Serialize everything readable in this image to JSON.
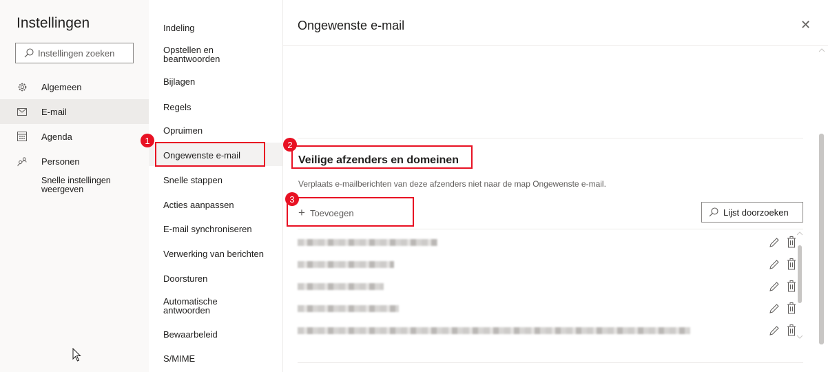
{
  "left": {
    "title": "Instellingen",
    "search_placeholder": "Instellingen zoeken",
    "items": [
      {
        "label": "Algemeen",
        "icon": "gear-icon"
      },
      {
        "label": "E-mail",
        "icon": "mail-icon"
      },
      {
        "label": "Agenda",
        "icon": "calendar-icon"
      },
      {
        "label": "Personen",
        "icon": "people-icon"
      }
    ],
    "quick_settings": "Snelle instellingen weergeven"
  },
  "middle": {
    "items": [
      "Indeling",
      "Opstellen en beantwoorden",
      "Bijlagen",
      "Regels",
      "Opruimen",
      "Ongewenste e-mail",
      "Snelle stappen",
      "Acties aanpassen",
      "E-mail synchroniseren",
      "Verwerking van berichten",
      "Doorsturen",
      "Automatische antwoorden",
      "Bewaarbeleid",
      "S/MIME"
    ],
    "selected": "Ongewenste e-mail"
  },
  "right": {
    "title": "Ongewenste e-mail",
    "section_title": "Veilige afzenders en domeinen",
    "section_desc": "Verplaats e-mailberichten van deze afzenders niet naar de map Ongewenste e-mail.",
    "add_label": "Toevoegen",
    "list_search_label": "Lijst doorzoeken",
    "rows": 5
  },
  "callouts": [
    "1",
    "2",
    "3"
  ],
  "colors": {
    "accent": "#e81123",
    "selected_bg": "#edebe9"
  }
}
